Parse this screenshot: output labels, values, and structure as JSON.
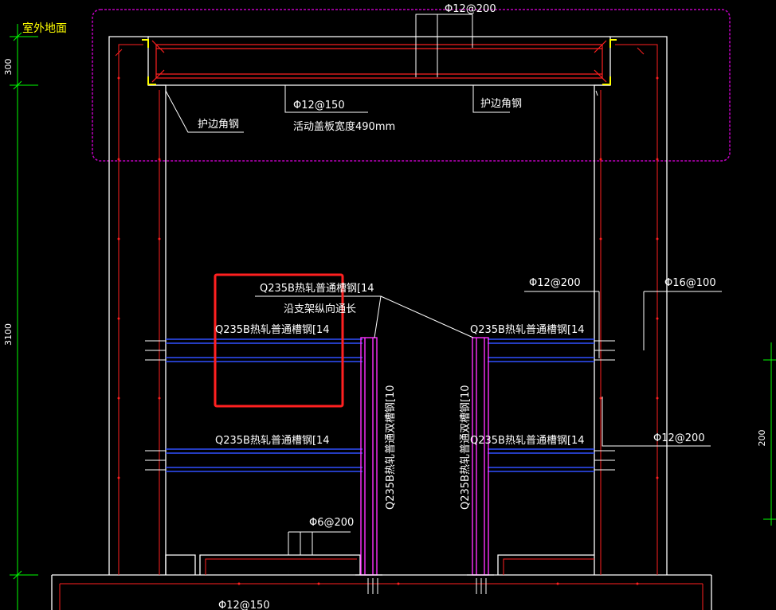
{
  "colors": {
    "background": "#000000",
    "concrete_outline": "#ffffff",
    "rebar": "#ff2020",
    "channel_steel": "#3050ff",
    "column": "#ff30ff",
    "cloud": "#c000c0",
    "highlight": "#ff2020",
    "dimension": "#00ff00",
    "ground_label": "#ffff00",
    "angle_steel": "#ffff00"
  },
  "ground_label": "室外地面",
  "dimensions": {
    "top": "300",
    "middle": "3100",
    "right": "200"
  },
  "labels": {
    "top_rebar": "Φ12@200",
    "cover_rebar": "Φ12@150",
    "cover_width": "活动盖板宽度490mm",
    "angle_left": "护边角钢",
    "angle_right": "护边角钢",
    "longitudinal_channel": "Q235B热轧普通槽钢[14",
    "longitudinal_note": "沿支架纵向通长",
    "beam_upper_left": "Q235B热轧普通槽钢[14",
    "beam_upper_right": "Q235B热轧普通槽钢[14",
    "beam_lower_left": "Q235B热轧普通槽钢[14",
    "beam_lower_right": "Q235B热轧普通槽钢[14",
    "column_left": "Q235B热轧普通双槽钢[10",
    "column_right": "Q235B热轧普通双槽钢[10",
    "wall_rebar": "Φ12@200",
    "wall_outer_rebar": "Φ16@100",
    "wall_side_rebar": "Φ12@200",
    "floor_rebar": "Φ6@200",
    "base_rebar": "Φ12@150"
  }
}
